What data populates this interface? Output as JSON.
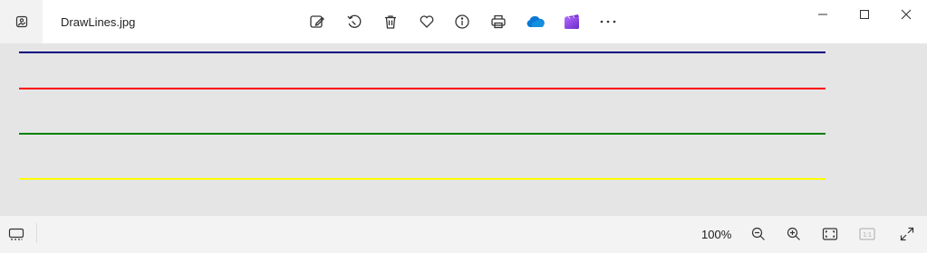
{
  "titlebar": {
    "file_name": "DrawLines.jpg",
    "app_icon": "photos-app-icon",
    "toolbar": [
      {
        "name": "edit-image-icon"
      },
      {
        "name": "rotate-icon"
      },
      {
        "name": "delete-icon"
      },
      {
        "name": "favorite-icon"
      },
      {
        "name": "info-icon"
      },
      {
        "name": "print-icon"
      },
      {
        "name": "onedrive-icon",
        "color": "#0a78d4"
      },
      {
        "name": "clipchamp-icon",
        "color": "#8a45d8"
      },
      {
        "name": "more-options-icon",
        "glyph": "···"
      }
    ],
    "window_controls": [
      "minimize-icon",
      "maximize-icon",
      "close-icon"
    ]
  },
  "image": {
    "lines": [
      {
        "color": "#000080"
      },
      {
        "color": "#ff0000"
      },
      {
        "color": "#008000"
      },
      {
        "color": "#ffff00"
      }
    ]
  },
  "statusbar": {
    "zoom_level": "100%",
    "actual_size_label": "1:1"
  },
  "colors": {
    "accent": "#0a78d4",
    "background": "#e5e5e5"
  }
}
